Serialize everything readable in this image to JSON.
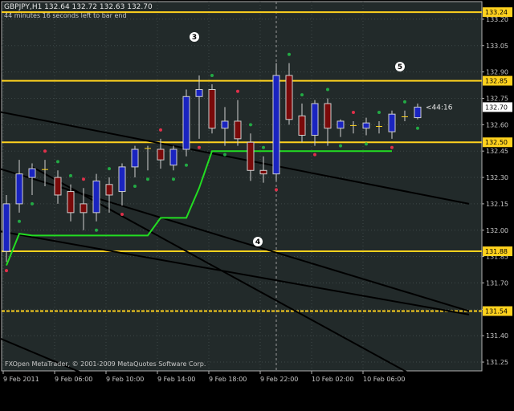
{
  "header": {
    "symbol_line": "GBPJPY,H1  132.64 132.72 132.63 132.70",
    "timer_text": "44 minutes 16 seconds left to bar end"
  },
  "footer": {
    "copyright": "FXOpen MetaTrader, © 2001-2009 MetaQuotes Software Corp."
  },
  "markers": [
    "3",
    "5",
    "4"
  ],
  "current_price_tag": "132.70",
  "countdown_label": "<44:16",
  "chart_data": {
    "type": "candlestick",
    "title": "GBPJPY,H1",
    "ylim": [
      131.2,
      133.3
    ],
    "price_axis": {
      "ticks": [
        "133.20",
        "133.05",
        "132.90",
        "132.75",
        "132.60",
        "132.45",
        "132.30",
        "132.15",
        "132.00",
        "131.85",
        "131.70",
        "131.55",
        "131.40",
        "131.25"
      ]
    },
    "time_axis": {
      "ticks": [
        "9 Feb 2011",
        "9 Feb 06:00",
        "9 Feb 10:00",
        "9 Feb 14:00",
        "9 Feb 18:00",
        "9 Feb 22:00",
        "10 Feb 02:00",
        "10 Feb 06:00"
      ]
    },
    "horizontal_levels": [
      {
        "price": 133.24,
        "label": "133.24",
        "style": "solid"
      },
      {
        "price": 132.85,
        "label": "132.85",
        "style": "solid"
      },
      {
        "price": 132.5,
        "label": "132.50",
        "style": "solid"
      },
      {
        "price": 131.88,
        "label": "131.88",
        "style": "solid"
      },
      {
        "price": 131.54,
        "label": "131.54",
        "style": "dashed"
      }
    ],
    "current_price": 132.7,
    "vertical_marker_index": 21,
    "candles": [
      {
        "o": 131.88,
        "h": 132.2,
        "l": 131.82,
        "c": 132.15
      },
      {
        "o": 132.15,
        "h": 132.4,
        "l": 132.1,
        "c": 132.32
      },
      {
        "o": 132.3,
        "h": 132.38,
        "l": 132.2,
        "c": 132.35
      },
      {
        "o": 132.35,
        "h": 132.4,
        "l": 132.25,
        "c": 132.34
      },
      {
        "o": 132.3,
        "h": 132.34,
        "l": 132.15,
        "c": 132.2
      },
      {
        "o": 132.22,
        "h": 132.26,
        "l": 132.05,
        "c": 132.1
      },
      {
        "o": 132.15,
        "h": 132.24,
        "l": 132.0,
        "c": 132.1
      },
      {
        "o": 132.1,
        "h": 132.32,
        "l": 132.05,
        "c": 132.28
      },
      {
        "o": 132.26,
        "h": 132.3,
        "l": 132.1,
        "c": 132.2
      },
      {
        "o": 132.22,
        "h": 132.38,
        "l": 132.14,
        "c": 132.36
      },
      {
        "o": 132.36,
        "h": 132.48,
        "l": 132.3,
        "c": 132.46
      },
      {
        "o": 132.46,
        "h": 132.48,
        "l": 132.34,
        "c": 132.47
      },
      {
        "o": 132.46,
        "h": 132.52,
        "l": 132.35,
        "c": 132.4
      },
      {
        "o": 132.37,
        "h": 132.48,
        "l": 132.34,
        "c": 132.46
      },
      {
        "o": 132.46,
        "h": 132.8,
        "l": 132.42,
        "c": 132.76
      },
      {
        "o": 132.76,
        "h": 132.88,
        "l": 132.52,
        "c": 132.8
      },
      {
        "o": 132.8,
        "h": 132.83,
        "l": 132.55,
        "c": 132.58
      },
      {
        "o": 132.58,
        "h": 132.7,
        "l": 132.48,
        "c": 132.62
      },
      {
        "o": 132.62,
        "h": 132.74,
        "l": 132.48,
        "c": 132.52
      },
      {
        "o": 132.5,
        "h": 132.55,
        "l": 132.28,
        "c": 132.34
      },
      {
        "o": 132.34,
        "h": 132.42,
        "l": 132.27,
        "c": 132.32
      },
      {
        "o": 132.32,
        "h": 132.95,
        "l": 132.28,
        "c": 132.88
      },
      {
        "o": 132.88,
        "h": 132.95,
        "l": 132.6,
        "c": 132.63
      },
      {
        "o": 132.65,
        "h": 132.72,
        "l": 132.5,
        "c": 132.54
      },
      {
        "o": 132.54,
        "h": 132.74,
        "l": 132.48,
        "c": 132.72
      },
      {
        "o": 132.72,
        "h": 132.75,
        "l": 132.48,
        "c": 132.58
      },
      {
        "o": 132.58,
        "h": 132.63,
        "l": 132.53,
        "c": 132.62
      },
      {
        "o": 132.6,
        "h": 132.62,
        "l": 132.55,
        "c": 132.59
      },
      {
        "o": 132.58,
        "h": 132.64,
        "l": 132.54,
        "c": 132.61
      },
      {
        "o": 132.6,
        "h": 132.62,
        "l": 132.55,
        "c": 132.58
      },
      {
        "o": 132.56,
        "h": 132.68,
        "l": 132.52,
        "c": 132.66
      },
      {
        "o": 132.65,
        "h": 132.68,
        "l": 132.62,
        "c": 132.64
      },
      {
        "o": 132.64,
        "h": 132.72,
        "l": 132.63,
        "c": 132.7
      }
    ],
    "green_line": [
      131.8,
      131.98,
      131.97,
      131.97,
      131.97,
      131.97,
      131.97,
      131.97,
      131.97,
      131.97,
      131.97,
      131.97,
      132.07,
      132.07,
      132.07,
      132.24,
      132.45,
      132.45,
      132.45,
      132.45,
      132.45,
      132.45,
      132.45,
      132.45,
      132.45,
      132.45,
      132.45,
      132.45,
      132.45,
      132.45,
      132.45
    ],
    "trendlines": [
      {
        "start": [
          -1,
          132.68
        ],
        "end": [
          36,
          132.15
        ]
      },
      {
        "start": [
          -1,
          132.36
        ],
        "end": [
          36,
          131.54
        ]
      },
      {
        "start": [
          -1,
          132.0
        ],
        "end": [
          36,
          131.52
        ]
      },
      {
        "start": [
          2,
          132.36
        ],
        "end": [
          36,
          131.0
        ]
      },
      {
        "start": [
          -1,
          131.4
        ],
        "end": [
          12,
          131.0
        ]
      }
    ]
  }
}
